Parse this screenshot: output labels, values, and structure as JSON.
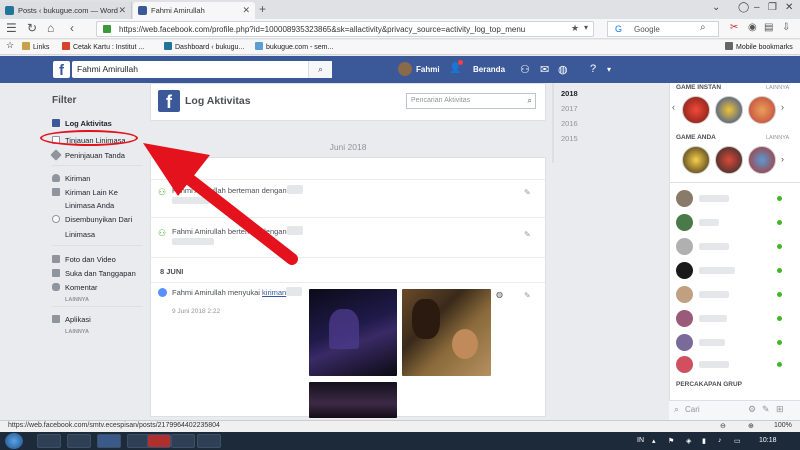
{
  "browser": {
    "tabs": [
      {
        "label": "Posts ‹ bukugue.com — Word"
      },
      {
        "label": "Fahmi Amirullah"
      }
    ],
    "url": "https://web.facebook.com/profile.php?id=100008935323865&sk=allactivity&privacy_source=activity_log_top_menu",
    "search_engine": "Google",
    "bookmarks": [
      {
        "label": "Links"
      },
      {
        "label": "Cetak Kartu : Institut ..."
      },
      {
        "label": "Dashboard ‹ bukugu..."
      },
      {
        "label": "bukugue.com - sem..."
      }
    ],
    "mobile_bookmarks": "Mobile bookmarks"
  },
  "fb_header": {
    "search_value": "Fahmi Amirullah",
    "user_name": "Fahmi",
    "home_label": "Beranda"
  },
  "filter": {
    "title": "Filter",
    "items": [
      {
        "label": "Log Aktivitas"
      },
      {
        "label": "Tinjauan Linimasa"
      },
      {
        "label": "Peninjauan Tanda"
      },
      {
        "label": "Kiriman"
      },
      {
        "label": "Kiriman Lain Ke"
      },
      {
        "label": "Linimasa Anda"
      },
      {
        "label": "Disembunyikan Dari"
      },
      {
        "label": "Linimasa"
      },
      {
        "label": "Foto dan Video"
      },
      {
        "label": "Suka dan Tanggapan"
      },
      {
        "label": "Komentar"
      },
      {
        "label": "LAINNYA"
      },
      {
        "label": "Aplikasi"
      },
      {
        "label": "LAINNYA"
      }
    ]
  },
  "activity": {
    "title": "Log Aktivitas",
    "search_placeholder": "Pencarian Aktivitas",
    "month": "Juni 2018",
    "rows": [
      {
        "text": "Fahmi Amirullah berteman dengan"
      },
      {
        "text": "Fahmi Amirullah berteman dengan"
      }
    ],
    "section": "8 JUNI",
    "like_row": {
      "text": "Fahmi Amirullah menyukai",
      "link": "kiriman",
      "date": "9 Juni 2018 2:22"
    }
  },
  "years": [
    "2018",
    "2017",
    "2016",
    "2015"
  ],
  "right_sidebar": {
    "instant_games": "GAME INSTAN",
    "your_games": "GAME ANDA",
    "more": "LAINNYA",
    "group_chat": "PERCAKAPAN GRUP",
    "chat_search": "Cari"
  },
  "status_url": "https://web.facebook.com/smtv.ecespisan/posts/2179964402235804",
  "taskbar": {
    "lang": "IN",
    "time": "10:18",
    "zoom": "100%"
  }
}
